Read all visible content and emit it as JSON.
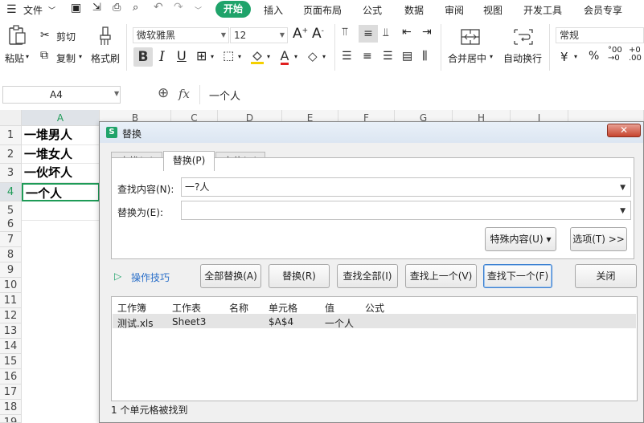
{
  "menu": {
    "file": "文件",
    "items": [
      "开始",
      "插入",
      "页面布局",
      "公式",
      "数据",
      "审阅",
      "视图",
      "开发工具",
      "会员专享"
    ]
  },
  "ribbon": {
    "paste": "粘贴",
    "cut": "剪切",
    "copy": "复制",
    "format_painter": "格式刷",
    "font_name": "微软雅黑",
    "font_size": "12",
    "merge_center": "合并居中",
    "wrap_text": "自动换行",
    "number_format": "常规",
    "currency": "¥",
    "percent": "%"
  },
  "formula_bar": {
    "cell_ref": "A4",
    "fx": "fx",
    "content": "一个人"
  },
  "sheet": {
    "columns": [
      "A",
      "B",
      "C",
      "D",
      "E",
      "F",
      "G",
      "H",
      "I"
    ],
    "rows": [
      "1",
      "2",
      "3",
      "4",
      "5",
      "6",
      "7",
      "8",
      "9",
      "10",
      "11",
      "12",
      "13",
      "14",
      "15",
      "16",
      "17",
      "18",
      "19"
    ],
    "cells": [
      "一堆男人",
      "一堆女人",
      "一伙坏人",
      "一个人"
    ],
    "selected_row": "4",
    "colors": {
      "accent": "#1fa36a",
      "selection": "#1e9b57"
    }
  },
  "dialog": {
    "title": "替换",
    "close": "✕",
    "tabs": [
      "查找(D)",
      "替换(P)",
      "定位(G)"
    ],
    "active_tab": "替换(P)",
    "find_label": "查找内容(N):",
    "find_value": "一?人",
    "replace_label": "替换为(E):",
    "replace_value": "",
    "special_button": "特殊内容(U) ▾",
    "options_button": "选项(T) >>",
    "tips": "操作技巧",
    "buttons": {
      "replace_all": "全部替换(A)",
      "replace": "替换(R)",
      "find_all": "查找全部(I)",
      "find_prev": "查找上一个(V)",
      "find_next": "查找下一个(F)",
      "close": "关闭"
    },
    "results": {
      "headers": [
        "工作簿",
        "工作表",
        "名称",
        "单元格",
        "值",
        "公式"
      ],
      "rows": [
        {
          "workbook": "测试.xls",
          "sheet": "Sheet3",
          "name": "",
          "cell": "$A$4",
          "value": "一个人",
          "formula": ""
        }
      ]
    },
    "status": "1 个单元格被找到"
  }
}
